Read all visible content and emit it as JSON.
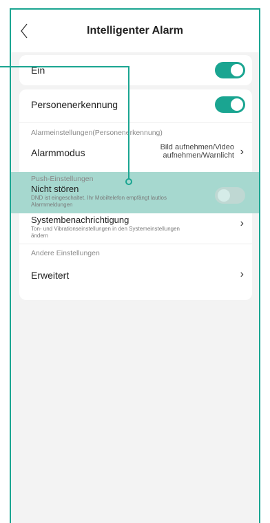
{
  "nav": {
    "title": "Intelligenter Alarm"
  },
  "items": {
    "ein": {
      "label": "Ein",
      "toggle_on": true
    },
    "personenerkennung": {
      "label": "Personenerkennung",
      "toggle_on": true
    },
    "alarm_section": "Alarmeinstellungen(Personenerkennung)",
    "alarmmodus": {
      "label": "Alarmmodus",
      "value_line1": "Bild aufnehmen/Video",
      "value_line2": "aufnehmen/Warnlicht"
    },
    "push_section": "Push-Einstellungen",
    "nicht_stoeren": {
      "label": "Nicht stören",
      "sub_line1": "DND ist eingeschaltet. Ihr Mobiltelefon empfängt lautlos",
      "sub_line2": "Alarmmeldungen",
      "toggle_on": false
    },
    "systembenachrichtigung": {
      "label": "Systembenachrichtigung",
      "sub_line1": "Ton- und Vibrationseinstellungen in den Systemeinstellungen",
      "sub_line2": "ändern"
    },
    "other_section": "Andere Einstellungen",
    "erweitert": {
      "label": "Erweitert"
    }
  },
  "glyphs": {
    "chevron": "›"
  },
  "colors": {
    "accent": "#1aa591",
    "highlight": "#a6d8cf",
    "background": "#f3f3f3"
  }
}
